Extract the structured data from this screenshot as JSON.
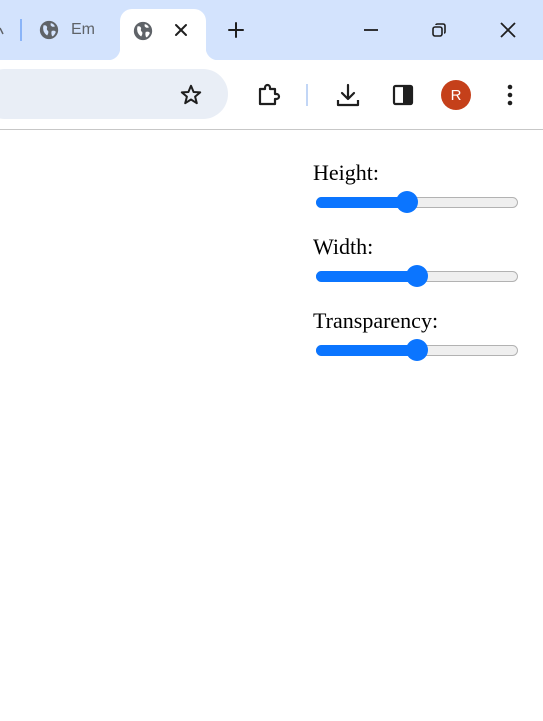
{
  "browser": {
    "tabs": [
      {
        "title": "Em",
        "active": false,
        "icon": "globe-icon"
      },
      {
        "title": "",
        "active": true,
        "icon": "globe-icon"
      }
    ],
    "accent_color": "#d3e3fd",
    "avatar": {
      "initial": "R",
      "color": "#c5401a"
    }
  },
  "controls": [
    {
      "label": "Height:",
      "value": 0.45
    },
    {
      "label": "Width:",
      "value": 0.5
    },
    {
      "label": "Transparency:",
      "value": 0.5
    }
  ],
  "slider_color": "#0b75ff"
}
